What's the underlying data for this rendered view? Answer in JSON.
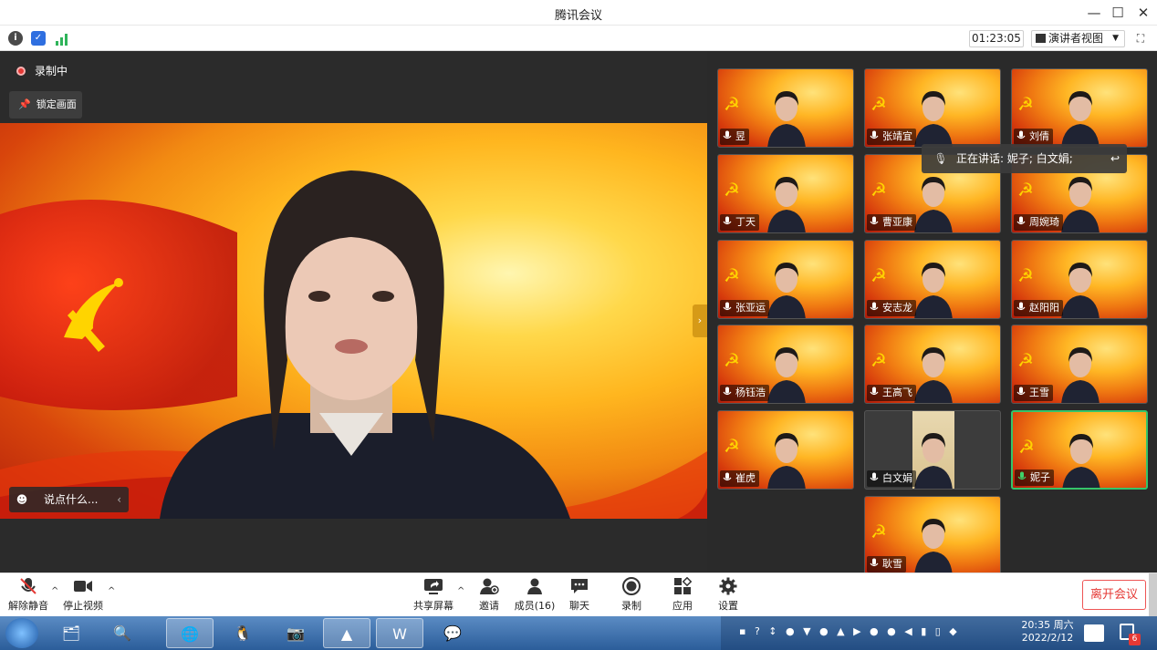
{
  "window": {
    "title": "腾讯会议"
  },
  "infobar": {
    "timer": "01:23:05",
    "view_label": "演讲者视图"
  },
  "stage": {
    "recording_label": "录制中",
    "lock_label": "锁定画面",
    "chat_placeholder": "说点什么..."
  },
  "speaking": {
    "text": "正在讲话: 妮子; 白文娟;"
  },
  "gallery": {
    "tiles": [
      {
        "name": "昱"
      },
      {
        "name": "张靖宜"
      },
      {
        "name": "刘倩"
      },
      {
        "name": "丁天"
      },
      {
        "name": "曹亚康"
      },
      {
        "name": "周婉琦"
      },
      {
        "name": "张亚运"
      },
      {
        "name": "安志龙"
      },
      {
        "name": "赵阳阳"
      },
      {
        "name": "杨钰浩"
      },
      {
        "name": "王高飞"
      },
      {
        "name": "王雪"
      },
      {
        "name": "崔虎"
      },
      {
        "name": "白文娟"
      },
      {
        "name": "妮子"
      },
      {
        "name": "耿雪"
      }
    ]
  },
  "toolbar": {
    "unmute": "解除静音",
    "stop_video": "停止视频",
    "share": "共享屏幕",
    "invite": "邀请",
    "members": "成员(16)",
    "chat": "聊天",
    "record": "录制",
    "apps": "应用",
    "settings": "设置",
    "leave": "离开会议"
  },
  "taskbar": {
    "time": "20:35 周六",
    "date": "2022/2/12",
    "badge": "6"
  }
}
